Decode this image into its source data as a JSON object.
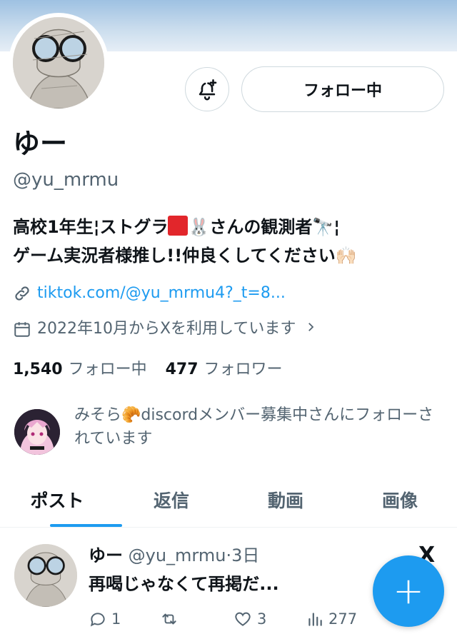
{
  "profile": {
    "display_name": "ゆー",
    "handle": "@yu_mrmu",
    "bio_line1_a": "高校1年生¦ストグラ",
    "bio_line1_b": "🐰",
    "bio_line1_c": "さんの観測者",
    "bio_line1_d": "🔭",
    "bio_line1_e": "¦",
    "bio_line2": "ゲーム実況者様推し!!仲良くしてください🙌🏻",
    "link": "tiktok.com/@yu_mrmu4?_t=8...",
    "joined": "2022年10月からXを利用しています",
    "following_count": "1,540",
    "following_label": "フォロー中",
    "followers_count": "477",
    "followers_label": "フォロワー"
  },
  "buttons": {
    "follow_label": "フォロー中",
    "notify_icon": "bell-plus-icon"
  },
  "followed_by": {
    "text": "みそら🥐discordメンバー募集中さんにフォローされています"
  },
  "tabs": [
    {
      "label": "ポスト",
      "active": true
    },
    {
      "label": "返信",
      "active": false
    },
    {
      "label": "動画",
      "active": false
    },
    {
      "label": "画像",
      "active": false
    }
  ],
  "post": {
    "name": "ゆー",
    "handle": "@yu_mrmu",
    "time": "·3日",
    "text": "再喝じゃなくて再掲だ...",
    "replies": "1",
    "likes": "3",
    "views": "277",
    "logo": "X"
  },
  "fab": {
    "label": "+"
  },
  "colors": {
    "accent": "#1d9bf0",
    "text_primary": "#0f1419",
    "text_secondary": "#536471",
    "border": "#cfd9de"
  }
}
